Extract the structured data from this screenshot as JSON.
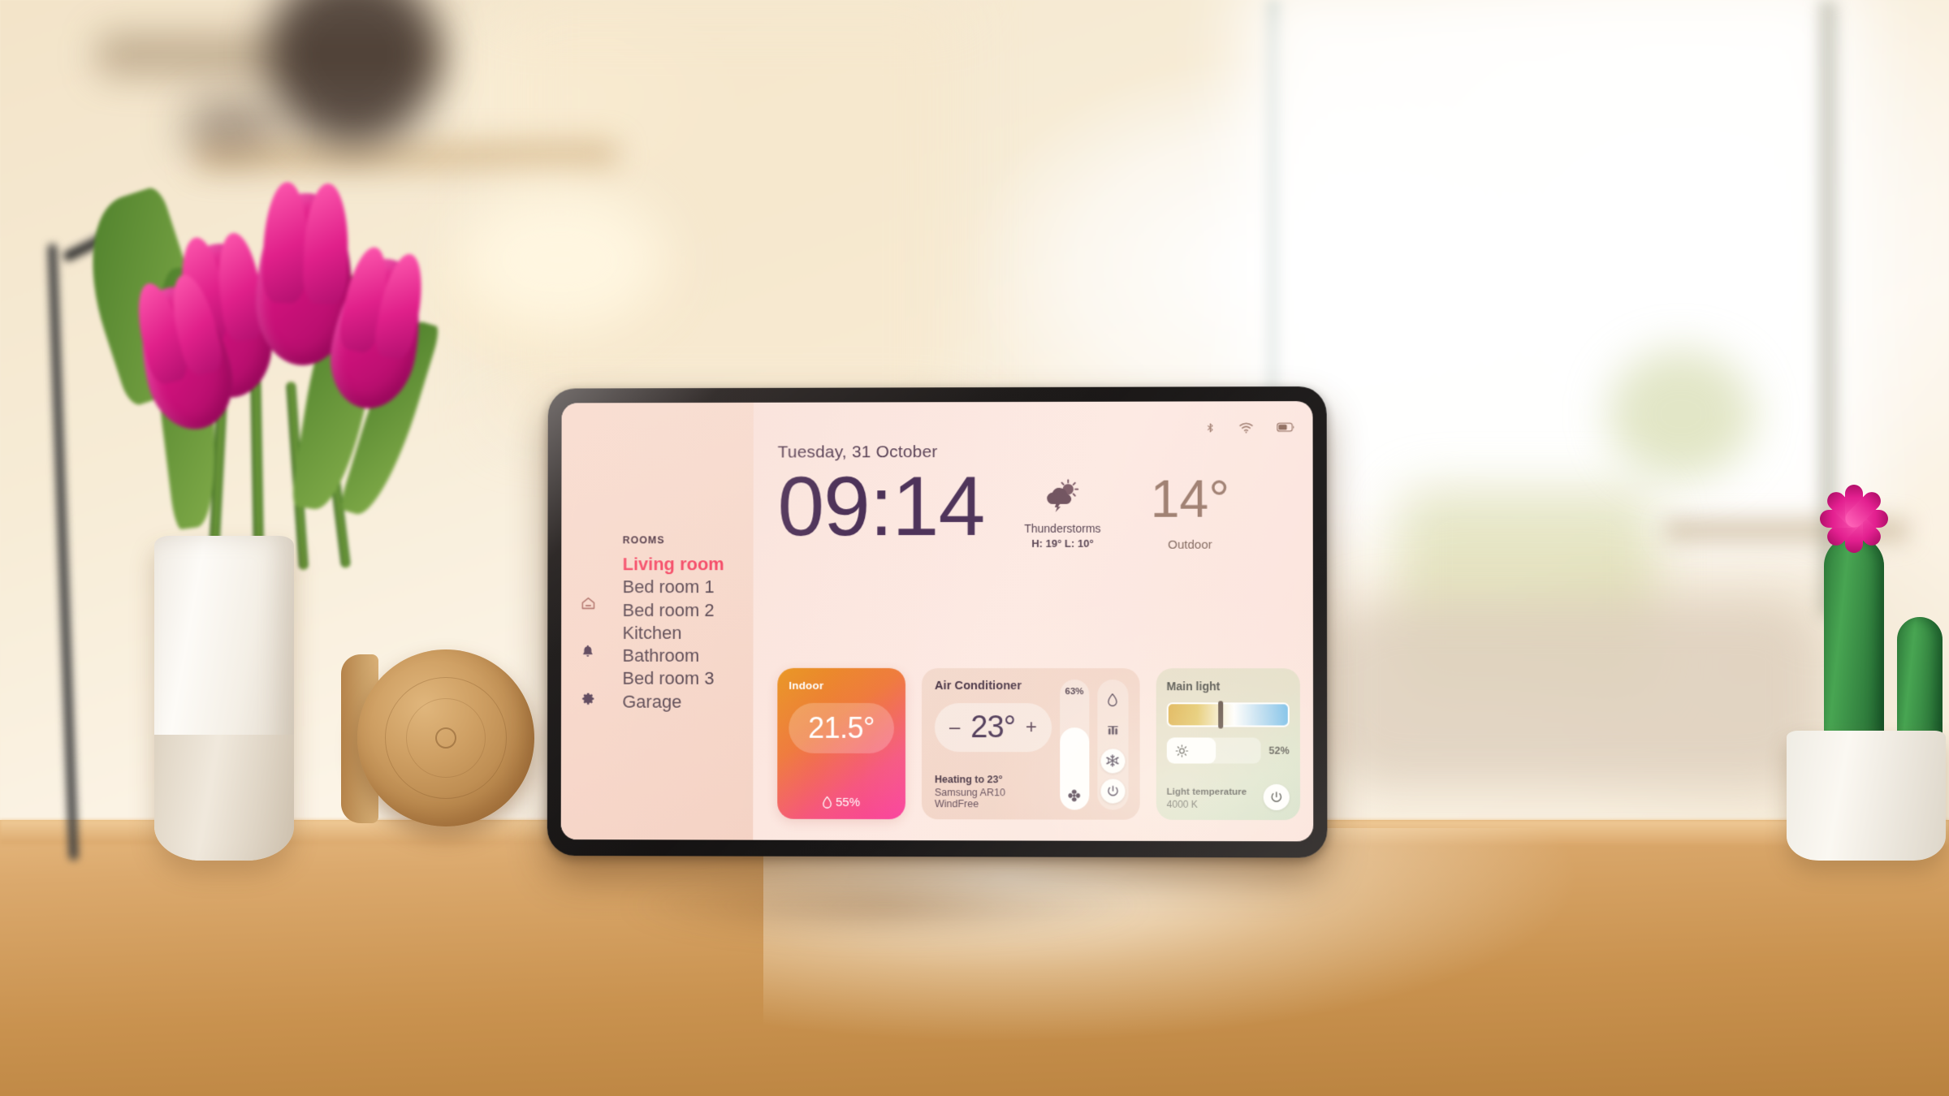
{
  "device": {
    "kind": "tablet-smart-home-dashboard"
  },
  "statusbar": {
    "icons": [
      "bluetooth-icon",
      "wifi-icon",
      "battery-icon"
    ],
    "battery_level_pct": 60
  },
  "sidebar": {
    "section_label": "ROOMS",
    "rail_icons": [
      "home-icon",
      "bell-icon",
      "gear-icon"
    ],
    "rooms": [
      {
        "label": "Living room",
        "active": true
      },
      {
        "label": "Bed room 1",
        "active": false
      },
      {
        "label": "Bed room 2",
        "active": false
      },
      {
        "label": "Kitchen",
        "active": false
      },
      {
        "label": "Bathroom",
        "active": false
      },
      {
        "label": "Bed room 3",
        "active": false
      },
      {
        "label": "Garage",
        "active": false
      }
    ]
  },
  "header": {
    "date": "Tuesday, 31 October",
    "time": "09:14",
    "weather": {
      "icon": "thunderstorm-icon",
      "condition": "Thunderstorms",
      "high_low": "H: 19°  L: 10°",
      "outdoor_temp": "14°",
      "outdoor_label": "Outdoor"
    }
  },
  "cards": {
    "indoor": {
      "title": "Indoor",
      "temperature": "21.5°",
      "humidity": "55%",
      "humidity_icon": "droplet-icon",
      "gradient_from": "#e8951f",
      "gradient_to": "#fa3d9c"
    },
    "air_conditioner": {
      "title": "Air Conditioner",
      "temperature": "23°",
      "decrease_label": "–",
      "increase_label": "+",
      "status_line": "Heating to 23°",
      "device_name": "Samsung AR10 WindFree",
      "fan": {
        "percent_label": "63%",
        "percent_value": 63,
        "icon": "fan-icon"
      },
      "modes": [
        {
          "icon": "droplet-icon",
          "active": false
        },
        {
          "icon": "heat-waves-icon",
          "active": false
        },
        {
          "icon": "snowflake-icon",
          "active": true
        },
        {
          "icon": "power-icon",
          "active": true
        }
      ]
    },
    "main_light": {
      "title": "Main light",
      "color_temp_handle_pct": 42,
      "brightness_icon": "sun-icon",
      "brightness_label": "52%",
      "brightness_value": 52,
      "temp_label": "Light temperature",
      "temp_value": "4000 K",
      "power_icon": "power-icon"
    }
  }
}
